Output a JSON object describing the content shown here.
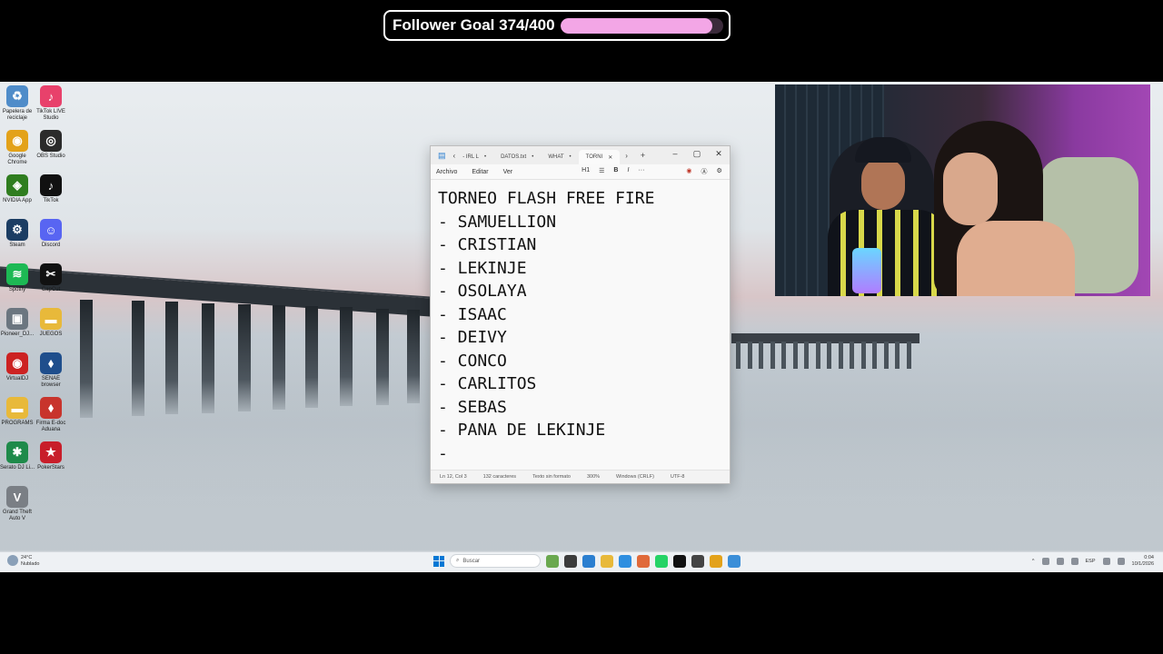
{
  "overlay": {
    "goal_label": "Follower Goal 374/400",
    "goal_current": 374,
    "goal_target": 400,
    "goal_fill_color": "#f3a6e6"
  },
  "desktop_icons": [
    {
      "label": "Papelera de reciclaje",
      "icon": "recycle-bin-icon",
      "color": "#4f8cc9",
      "glyph": "♻"
    },
    {
      "label": "TikTok LIVE Studio",
      "icon": "tiktok-live-icon",
      "color": "#e8416b",
      "glyph": "♪"
    },
    {
      "label": "Google Chrome",
      "icon": "chrome-icon",
      "color": "#e3a21a",
      "glyph": "◉"
    },
    {
      "label": "OBS Studio",
      "icon": "obs-icon",
      "color": "#2b2b2b",
      "glyph": "◎"
    },
    {
      "label": "NVIDIA App",
      "icon": "nvidia-icon",
      "color": "#2f7d1f",
      "glyph": "◈"
    },
    {
      "label": "TikTok",
      "icon": "tiktok-icon",
      "color": "#111111",
      "glyph": "♪"
    },
    {
      "label": "Steam",
      "icon": "steam-icon",
      "color": "#1b3d63",
      "glyph": "⚙"
    },
    {
      "label": "Discord",
      "icon": "discord-icon",
      "color": "#5865f2",
      "glyph": "☺"
    },
    {
      "label": "Spotify",
      "icon": "spotify-icon",
      "color": "#1db954",
      "glyph": "≋"
    },
    {
      "label": "CapCut",
      "icon": "capcut-icon",
      "color": "#111111",
      "glyph": "✂"
    },
    {
      "label": "Pioneer_DJ...",
      "icon": "pioneer-icon",
      "color": "#6b7680",
      "glyph": "▣"
    },
    {
      "label": "JUEGOS",
      "icon": "folder-icon",
      "color": "#e8b93a",
      "glyph": "▬"
    },
    {
      "label": "VirtualDJ",
      "icon": "virtualdj-icon",
      "color": "#cc2222",
      "glyph": "◉"
    },
    {
      "label": "SENAE browser",
      "icon": "senae-icon",
      "color": "#1f4e8c",
      "glyph": "⬧"
    },
    {
      "label": "PROGRAMS",
      "icon": "folder-icon",
      "color": "#e8b93a",
      "glyph": "▬"
    },
    {
      "label": "Firma E-doc Aduana",
      "icon": "firma-icon",
      "color": "#c8342c",
      "glyph": "⬧"
    },
    {
      "label": "Serato DJ Li...",
      "icon": "serato-icon",
      "color": "#1e8a4a",
      "glyph": "✱"
    },
    {
      "label": "PokerStars",
      "icon": "pokerstars-icon",
      "color": "#c81e2a",
      "glyph": "★"
    },
    {
      "label": "Grand Theft Auto V",
      "icon": "gta-icon",
      "color": "#7a7f85",
      "glyph": "V"
    }
  ],
  "notepad": {
    "tabs": [
      {
        "label": "- IRL L",
        "active": false
      },
      {
        "label": "DATOS.txt",
        "active": false
      },
      {
        "label": "WHAT",
        "active": false
      },
      {
        "label": "TORNI",
        "active": true
      }
    ],
    "menu": [
      "Archivo",
      "Editar",
      "Ver"
    ],
    "heading_tool": "H1",
    "lines": [
      "TORNEO FLASH FREE FIRE",
      "- SAMUELLION",
      "- CRISTIAN",
      "- LEKINJE",
      "- OSOLAYA",
      "- ISAAC",
      "- DEIVY",
      "- CONCO",
      "- CARLITOS",
      "- SEBAS",
      "- PANA DE LEKINJE",
      "-"
    ],
    "status": {
      "position": "Ln 12, Col 3",
      "chars": "132 caracteres",
      "format": "Texto sin formato",
      "zoom": "300%",
      "line_endings": "Windows (CRLF)",
      "encoding": "UTF-8"
    }
  },
  "taskbar": {
    "weather_temp": "24°C",
    "weather_desc": "Nublado",
    "search_placeholder": "Buscar",
    "lang": "ESP",
    "time": "0:04",
    "date": "10/1/2026"
  }
}
